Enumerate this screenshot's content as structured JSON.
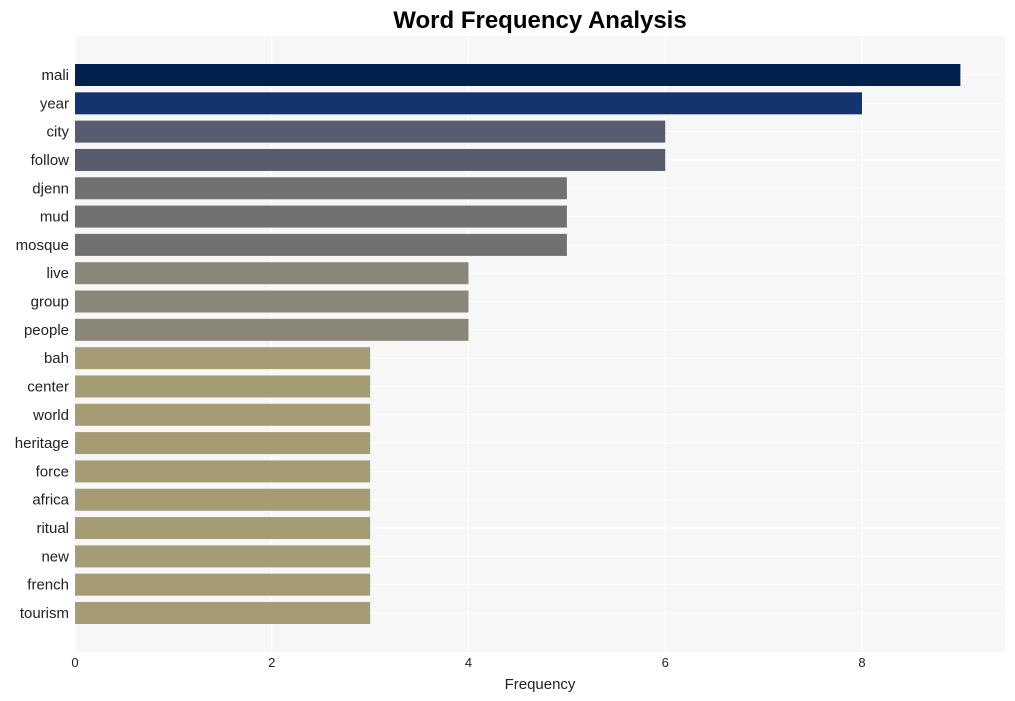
{
  "chart_data": {
    "type": "bar",
    "orientation": "horizontal",
    "title": "Word Frequency Analysis",
    "xlabel": "Frequency",
    "ylabel": "",
    "xlim": [
      0,
      9.45
    ],
    "xticks": [
      0,
      2,
      4,
      6,
      8
    ],
    "grid": true,
    "legend": "none",
    "categories": [
      "mali",
      "year",
      "city",
      "follow",
      "djenn",
      "mud",
      "mosque",
      "live",
      "group",
      "people",
      "bah",
      "center",
      "world",
      "heritage",
      "force",
      "africa",
      "ritual",
      "new",
      "french",
      "tourism"
    ],
    "values": [
      9,
      8,
      6,
      6,
      5,
      5,
      5,
      4,
      4,
      4,
      3,
      3,
      3,
      3,
      3,
      3,
      3,
      3,
      3,
      3
    ],
    "colors": [
      "#00204e",
      "#14346f",
      "#575c6e",
      "#575c6e",
      "#707173",
      "#707173",
      "#707173",
      "#8a8779",
      "#8a8779",
      "#8a8779",
      "#a59c74",
      "#a59c74",
      "#a59c74",
      "#a59c74",
      "#a59c74",
      "#a59c74",
      "#a59c74",
      "#a59c74",
      "#a59c74",
      "#a59c74"
    ]
  },
  "colors": {
    "plot_background": "#f7f7f7",
    "gridline": "#ffffff"
  }
}
